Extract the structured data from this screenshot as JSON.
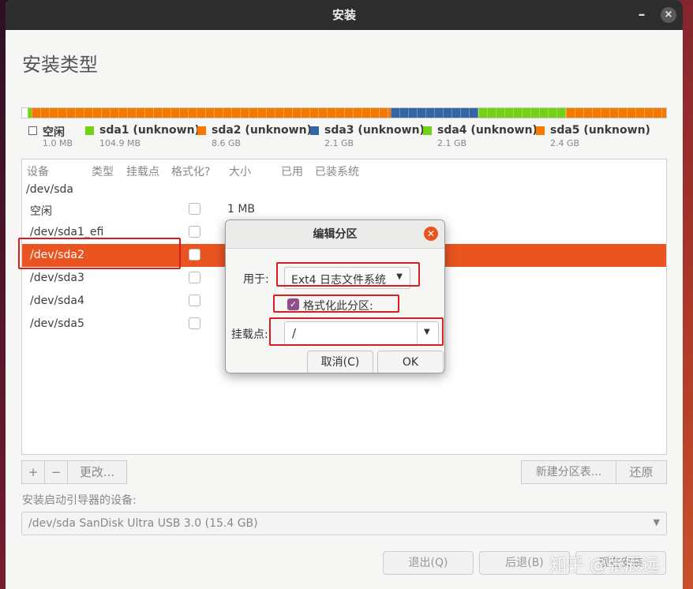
{
  "window": {
    "title": "安装",
    "minimize_glyph": "–",
    "close_glyph": "×"
  },
  "page": {
    "title": "安装类型"
  },
  "disk_bar": {
    "segments": [
      {
        "name": "free",
        "color": "#ffffff",
        "size_gb": 0.001
      },
      {
        "name": "sda1",
        "color": "#73d216",
        "size_gb": 0.1
      },
      {
        "name": "sda2",
        "color": "#f57900",
        "size_gb": 8.6
      },
      {
        "name": "sda3",
        "color": "#3465a4",
        "size_gb": 2.1
      },
      {
        "name": "sda4",
        "color": "#73d216",
        "size_gb": 2.1
      },
      {
        "name": "sda5",
        "color": "#f57900",
        "size_gb": 2.4
      }
    ]
  },
  "legend": [
    {
      "name": "空闲",
      "size": "1.0 MB",
      "color": "#ffffff"
    },
    {
      "name": "sda1 (unknown)",
      "size": "104.9 MB",
      "color": "#73d216"
    },
    {
      "name": "sda2 (unknown)",
      "size": "8.6 GB",
      "color": "#f57900"
    },
    {
      "name": "sda3 (unknown)",
      "size": "2.1 GB",
      "color": "#3465a4"
    },
    {
      "name": "sda4 (unknown)",
      "size": "2.1 GB",
      "color": "#73d216"
    },
    {
      "name": "sda5 (unknown)",
      "size": "2.4 GB",
      "color": "#f57900"
    }
  ],
  "table": {
    "headers": {
      "device": "设备",
      "type": "类型",
      "mount": "挂载点",
      "format": "格式化?",
      "size": "大小",
      "used": "已用",
      "installed": "已装系统"
    },
    "rows": [
      {
        "device": "/dev/sda",
        "indent": false,
        "checkbox": false,
        "size": ""
      },
      {
        "device": "空闲",
        "indent": true,
        "checkbox": true,
        "size": "1 MB"
      },
      {
        "device": "/dev/sda1_efi",
        "indent": true,
        "checkbox": true,
        "size": ""
      },
      {
        "device": "/dev/sda2",
        "indent": true,
        "checkbox": true,
        "size": "",
        "selected": true
      },
      {
        "device": "/dev/sda3",
        "indent": true,
        "checkbox": true,
        "size": ""
      },
      {
        "device": "/dev/sda4",
        "indent": true,
        "checkbox": true,
        "size": ""
      },
      {
        "device": "/dev/sda5",
        "indent": true,
        "checkbox": true,
        "size": ""
      }
    ]
  },
  "table_buttons": {
    "add": "+",
    "remove": "−",
    "change": "更改...",
    "new_table": "新建分区表...",
    "revert": "还原"
  },
  "bootloader": {
    "label": "安装启动引导器的设备:",
    "value": "/dev/sda SanDisk Ultra USB 3.0 (15.4 GB)"
  },
  "footer": {
    "quit": "退出(Q)",
    "back": "后退(B)",
    "install": "现在安装"
  },
  "watermark": "知乎 @张辰远",
  "dialog": {
    "title": "编辑分区",
    "use_label": "用于:",
    "use_value": "Ext4 日志文件系统",
    "format_label": "格式化此分区:",
    "format_checked": true,
    "mount_label": "挂载点:",
    "mount_value": "/",
    "cancel": "取消(C)",
    "ok": "OK"
  },
  "colors": {
    "accent": "#e95420",
    "check": "#924d8b",
    "highlight_box": "#d81e1e"
  }
}
